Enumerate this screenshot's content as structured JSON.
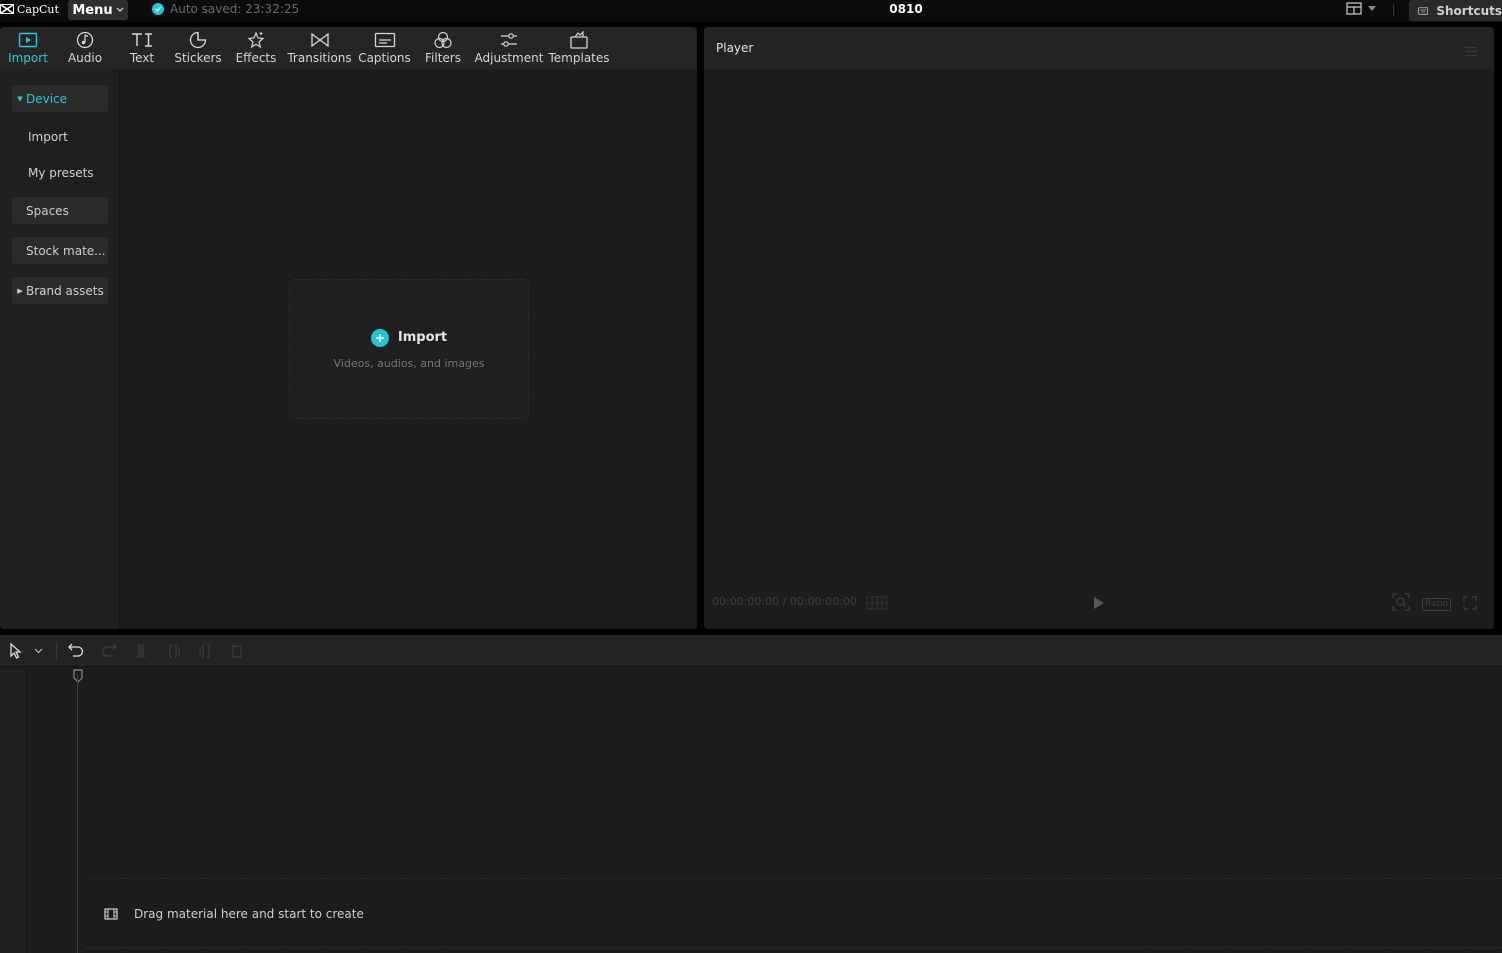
{
  "app": {
    "logo_text": "CapCut",
    "menu_label": "Menu",
    "autosave_text": "Auto saved: 23:32:25",
    "project_title": "0810",
    "shortcuts_label": "Shortcuts",
    "accent_color": "#1fc6d7"
  },
  "tabs": [
    {
      "label": "Import",
      "icon": "import-icon",
      "active": true
    },
    {
      "label": "Audio",
      "icon": "audio-icon"
    },
    {
      "label": "Text",
      "icon": "text-icon"
    },
    {
      "label": "Stickers",
      "icon": "sticker-icon"
    },
    {
      "label": "Effects",
      "icon": "effects-icon"
    },
    {
      "label": "Transitions",
      "icon": "transitions-icon"
    },
    {
      "label": "Captions",
      "icon": "captions-icon"
    },
    {
      "label": "Filters",
      "icon": "filters-icon"
    },
    {
      "label": "Adjustment",
      "icon": "adjustment-icon"
    },
    {
      "label": "Templates",
      "icon": "templates-icon"
    }
  ],
  "sidebar": {
    "items": [
      {
        "label": "Device"
      },
      {
        "label": "Import"
      },
      {
        "label": "My presets"
      },
      {
        "label": "Spaces"
      },
      {
        "label": "Stock mate..."
      },
      {
        "label": "Brand assets"
      }
    ]
  },
  "import_box": {
    "title": "Import",
    "subtitle": "Videos, audios, and images"
  },
  "player": {
    "title": "Player",
    "timecode": "00:00:00:00 / 00:00:00:00",
    "ratio_label": "Ratio"
  },
  "timeline": {
    "drag_hint": "Drag material here and start to create"
  }
}
